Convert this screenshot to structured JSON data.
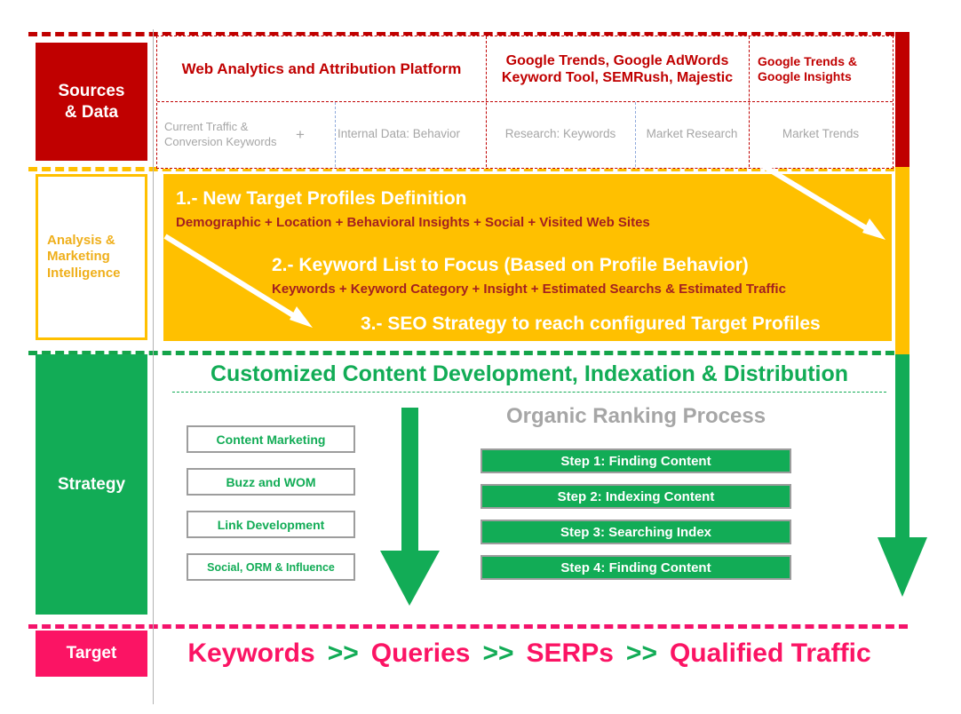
{
  "colors": {
    "red": "#C00000",
    "yellow": "#FFC000",
    "green": "#12AC56",
    "pink": "#FB1464",
    "grey": "#A6A6A6"
  },
  "rows": {
    "sources": {
      "label": "Sources\n& Data"
    },
    "analysis": {
      "label": "Analysis &\nMarketing\nIntelligence"
    },
    "strategy": {
      "label": "Strategy"
    },
    "target": {
      "label": "Target"
    }
  },
  "sources_table": {
    "headers": [
      "Web Analytics and Attribution Platform",
      "Google Trends, Google AdWords\nKeyword Tool, SEMRush, Majestic",
      "Google Trends &\nGoogle Insights"
    ],
    "subcells": [
      "Current Traffic  &\nConversion Keywords",
      "+",
      "Internal Data: Behavior",
      "Research: Keywords",
      "Market Research",
      "Market Trends"
    ]
  },
  "analysis_panel": {
    "items": [
      {
        "title": "1.- New Target Profiles Definition",
        "detail": "Demographic + Location + Behavioral Insights + Social + Visited Web Sites"
      },
      {
        "title": "2.- Keyword List to Focus (Based on Profile Behavior)",
        "detail": "Keywords + Keyword Category + Insight + Estimated Searchs & Estimated Traffic"
      },
      {
        "title": "3.- SEO Strategy to reach configured Target Profiles",
        "detail": ""
      }
    ]
  },
  "strategy_panel": {
    "title": "Customized Content Development, Indexation & Distribution",
    "chips": [
      "Content Marketing",
      "Buzz and WOM",
      "Link Development",
      "Social, ORM & Influence"
    ],
    "ranking_title": "Organic Ranking Process",
    "steps": [
      "Step 1: Finding Content",
      "Step 2: Indexing Content",
      "Step 3: Searching Index",
      "Step 4: Finding Content"
    ]
  },
  "target_flow": {
    "tokens": [
      {
        "text": "Keywords",
        "kind": "word"
      },
      {
        "text": ">>",
        "kind": "arrow"
      },
      {
        "text": "Queries",
        "kind": "word"
      },
      {
        "text": ">>",
        "kind": "arrow"
      },
      {
        "text": "SERPs",
        "kind": "word"
      },
      {
        "text": ">>",
        "kind": "arrow"
      },
      {
        "text": "Qualified Traffic",
        "kind": "word"
      }
    ]
  }
}
